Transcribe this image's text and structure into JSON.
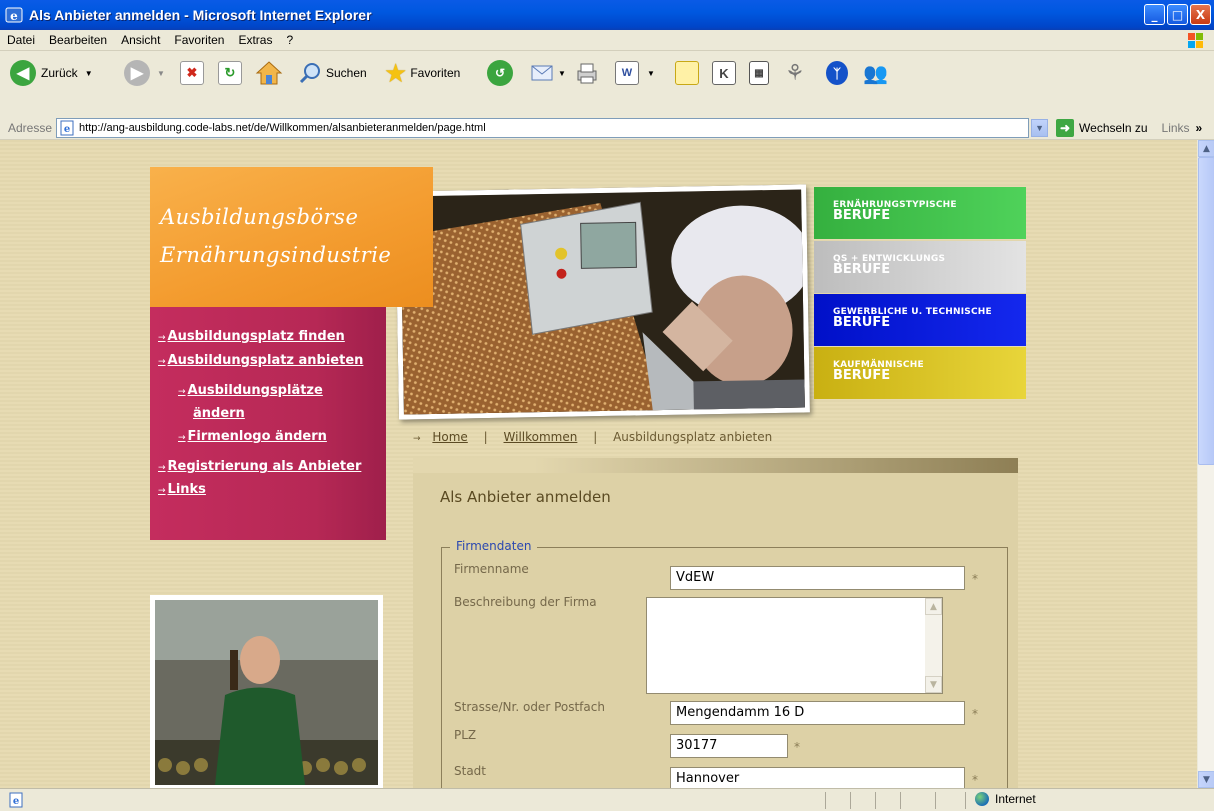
{
  "window": {
    "title": "Als Anbieter anmelden - Microsoft Internet Explorer",
    "minimize": "_",
    "maximize": "□",
    "close": "X"
  },
  "menu": [
    "Datei",
    "Bearbeiten",
    "Ansicht",
    "Favoriten",
    "Extras",
    "?"
  ],
  "toolbar": {
    "back_label": "Zurück",
    "search_label": "Suchen",
    "favorites_label": "Favoriten"
  },
  "address": {
    "label": "Adresse",
    "url": "http://ang-ausbildung.code-labs.net/de/Willkommen/alsanbieteranmelden/page.html",
    "go_label": "Wechseln zu",
    "links_label": "Links"
  },
  "site": {
    "logo_line1": "Ausbildungsbörse",
    "logo_line2": "Ernährungsindustrie",
    "nav": [
      "Ausbildungsplatz finden",
      "Ausbildungsplatz anbieten",
      "Ausbildungsplätze",
      "ändern",
      "Firmenlogo ändern",
      "Registrierung als Anbieter",
      "Links"
    ],
    "categories": [
      {
        "small": "ERNÄHRUNGSTYPISCHE",
        "big": "BERUFE",
        "color": "#3fbf4a"
      },
      {
        "small": "QS + ENTWICKLUNGS",
        "big": "BERUFE",
        "color": "#c8c8c8"
      },
      {
        "small": "GEWERBLICHE U. TECHNISCHE",
        "big": "BERUFE",
        "color": "#0a14d8"
      },
      {
        "small": "KAUFMÄNNISCHE",
        "big": "BERUFE",
        "color": "#d8c21e"
      }
    ],
    "breadcrumb": {
      "home": "Home",
      "welcome": "Willkommen",
      "current": "Ausbildungsplatz anbieten",
      "separator": "|"
    },
    "panel_title": "Als Anbieter anmelden",
    "form": {
      "legend": "Firmendaten",
      "fields": {
        "firmenname": {
          "label": "Firmenname",
          "value": "VdEW"
        },
        "beschreibung": {
          "label": "Beschreibung der Firma",
          "value": ""
        },
        "strasse": {
          "label": "Strasse/Nr. oder Postfach",
          "value": "Mengendamm 16 D"
        },
        "plz": {
          "label": "PLZ",
          "value": "30177"
        },
        "stadt": {
          "label": "Stadt",
          "value": "Hannover"
        }
      },
      "required_marker": "*"
    }
  },
  "status": {
    "zone": "Internet"
  }
}
